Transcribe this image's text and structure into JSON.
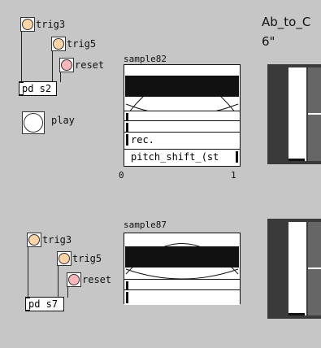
{
  "colors": {
    "bang_orange": "#fdd3a8",
    "bang_pink": "#f8b7bd",
    "bang_white": "#ffffff",
    "canvas_bg": "#c6c6c6"
  },
  "top": {
    "trig3": "trig3",
    "trig5": "trig5",
    "reset": "reset",
    "pd_obj": "pd s2",
    "play": "play",
    "array_name": "sample82",
    "rec": "rec.",
    "pitch": "pitch_shift_(st",
    "xmin": "0",
    "xmax": "1"
  },
  "bottom": {
    "trig3": "trig3",
    "trig5": "trig5",
    "reset": "reset",
    "pd_obj": "pd s7",
    "array_name": "sample87"
  },
  "right_panel": {
    "title_line1": "Ab_to_C",
    "title_line2": "6\""
  }
}
